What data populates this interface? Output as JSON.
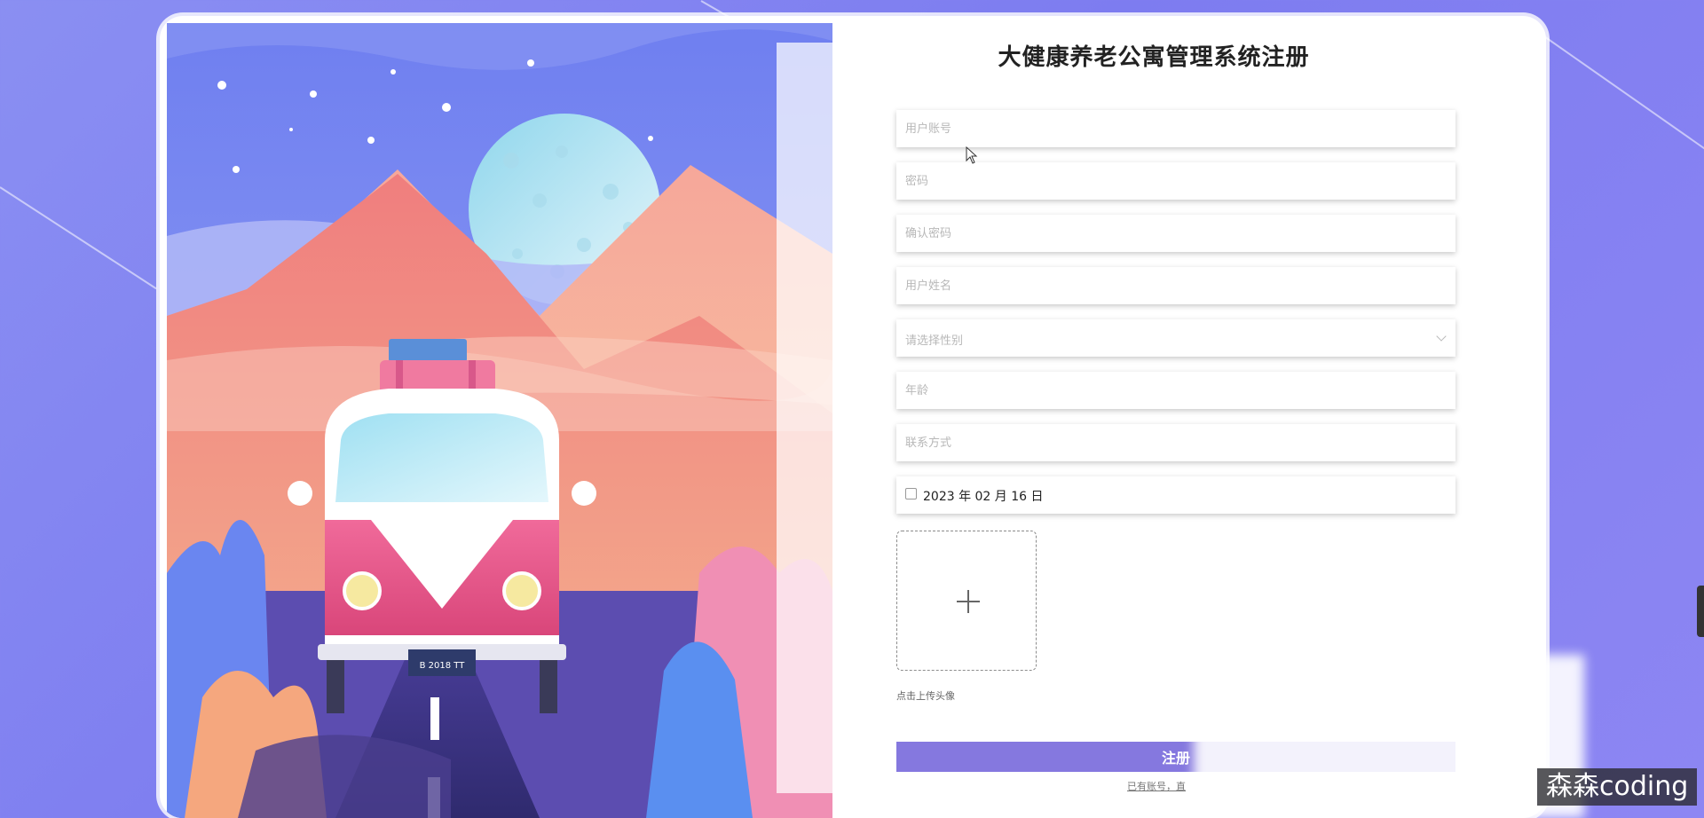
{
  "form": {
    "title": "大健康养老公寓管理系统注册",
    "fields": {
      "account": {
        "placeholder": "用户账号"
      },
      "password": {
        "placeholder": "密码"
      },
      "confirm_password": {
        "placeholder": "确认密码"
      },
      "name": {
        "placeholder": "用户姓名"
      },
      "gender": {
        "placeholder": "请选择性别"
      },
      "age": {
        "placeholder": "年龄"
      },
      "contact": {
        "placeholder": "联系方式"
      }
    },
    "date_value": "2023 年 02 月 16 日",
    "upload_hint": "点击上传头像",
    "register_label": "注册",
    "login_link": "已有账号，直"
  },
  "illustration": {
    "plate_text": "B 2018 TT"
  },
  "watermark": "森森coding",
  "colors": {
    "background": "#7d7cf0",
    "button": "#8578df",
    "sky": "#7c86f0",
    "mountain": "#f08f82"
  },
  "icons": {
    "gender_dropdown": "chevron-down-icon",
    "upload": "plus-icon"
  }
}
